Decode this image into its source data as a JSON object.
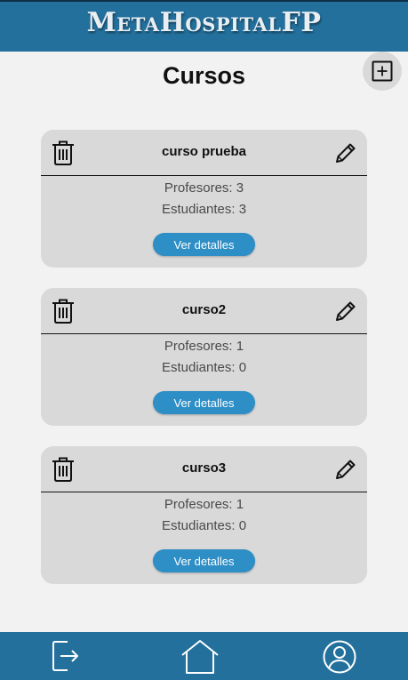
{
  "app": {
    "brand": "MetaHospitalFP"
  },
  "page": {
    "title": "Cursos"
  },
  "toolbar": {
    "add_icon": "plus-square-icon"
  },
  "courses": [
    {
      "name": "curso prueba",
      "teachers_label": "Profesores: 3",
      "students_label": "Estudiantes: 3",
      "button_label": "Ver detalles"
    },
    {
      "name": "curso2",
      "teachers_label": "Profesores: 1",
      "students_label": "Estudiantes: 0",
      "button_label": "Ver detalles"
    },
    {
      "name": "curso3",
      "teachers_label": "Profesores: 1",
      "students_label": "Estudiantes: 0",
      "button_label": "Ver detalles"
    }
  ],
  "bottom_nav": {
    "items": [
      {
        "icon": "logout-icon"
      },
      {
        "icon": "home-icon"
      },
      {
        "icon": "user-profile-icon"
      }
    ]
  },
  "colors": {
    "brand_blue": "#23709d",
    "button_blue": "#2e8ec6",
    "card_bg": "#d9d9d9",
    "page_bg": "#f2f2f2"
  }
}
